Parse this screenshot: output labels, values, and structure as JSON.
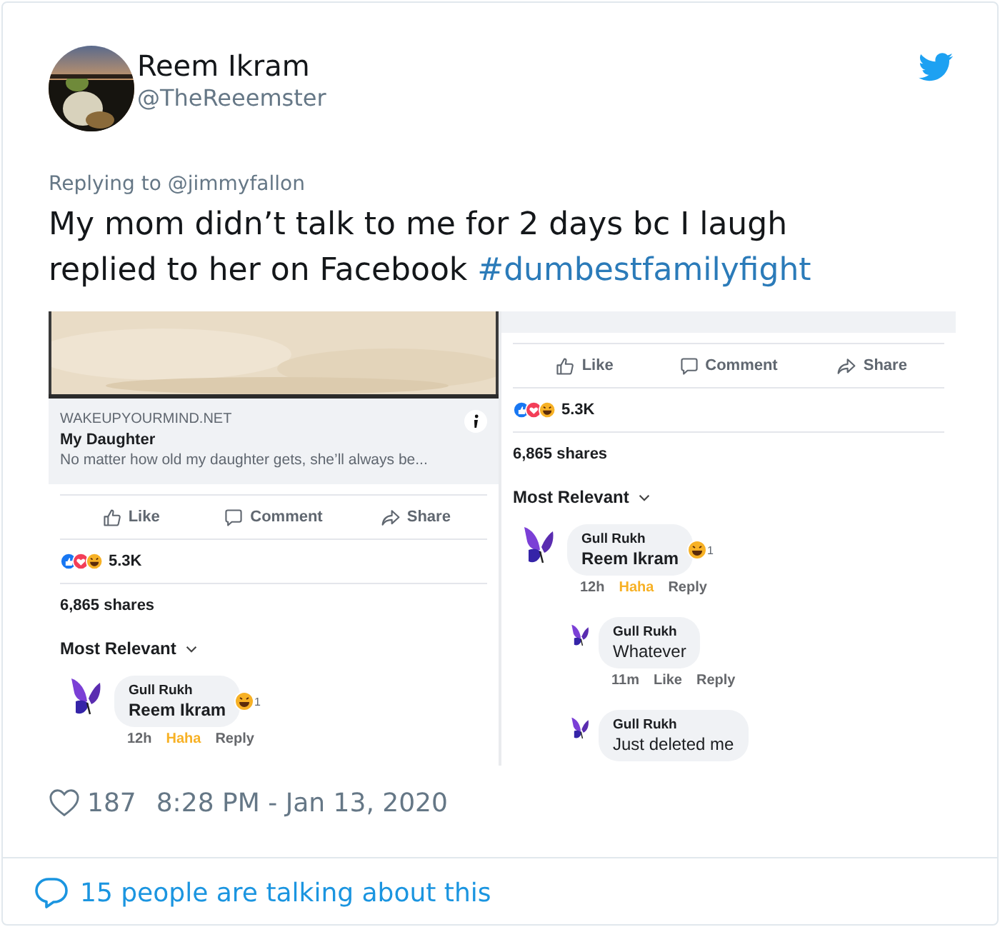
{
  "tweet": {
    "author": {
      "name": "Reem Ikram",
      "handle": "@TheReeemster"
    },
    "replying_to": "Replying to @jimmyfallon",
    "text": "My mom didn’t talk to me for 2 days bc I laugh replied to her on Facebook",
    "hashtag": "#dumbestfamilyfight"
  },
  "screenshots": [
    {
      "link_preview": {
        "kind": "picture",
        "domain": "WAKEUPYOURMIND.NET",
        "title": "My Daughter",
        "description": "No matter how old my daughter gets, she’ll always be..."
      },
      "actions": [
        {
          "kind": "like",
          "label": "Like"
        },
        {
          "kind": "comment",
          "label": "Comment"
        },
        {
          "kind": "share",
          "label": "Share"
        }
      ],
      "reaction_count": "5.3K",
      "shares": "6,865 shares",
      "sort": "Most Relevant",
      "comments": [
        {
          "author": "Gull Rukh",
          "text": "Reem Ikram",
          "mention": true,
          "reaction_count": "1",
          "time": "12h",
          "like_label": "Haha",
          "liked": true,
          "reply": "Reply"
        }
      ]
    },
    {
      "actions": [
        {
          "kind": "like",
          "label": "Like"
        },
        {
          "kind": "comment",
          "label": "Comment"
        },
        {
          "kind": "share",
          "label": "Share"
        }
      ],
      "reaction_count": "5.3K",
      "shares": "6,865 shares",
      "sort": "Most Relevant",
      "comments": [
        {
          "author": "Gull Rukh",
          "text": "Reem Ikram",
          "mention": true,
          "reaction_count": "1",
          "time": "12h",
          "like_label": "Haha",
          "liked": true,
          "reply": "Reply",
          "children": [
            {
              "author": "Gull Rukh",
              "text": "Whatever",
              "mention": false,
              "time": "11m",
              "like_label": "Like",
              "liked": false,
              "reply": "Reply"
            },
            {
              "author": "Gull Rukh",
              "text": "Just deleted me",
              "mention": false
            }
          ]
        }
      ]
    }
  ],
  "footer": {
    "likes": "187",
    "time": "8:28 PM - Jan 13, 2020"
  },
  "conversation": "15 people are talking about this"
}
